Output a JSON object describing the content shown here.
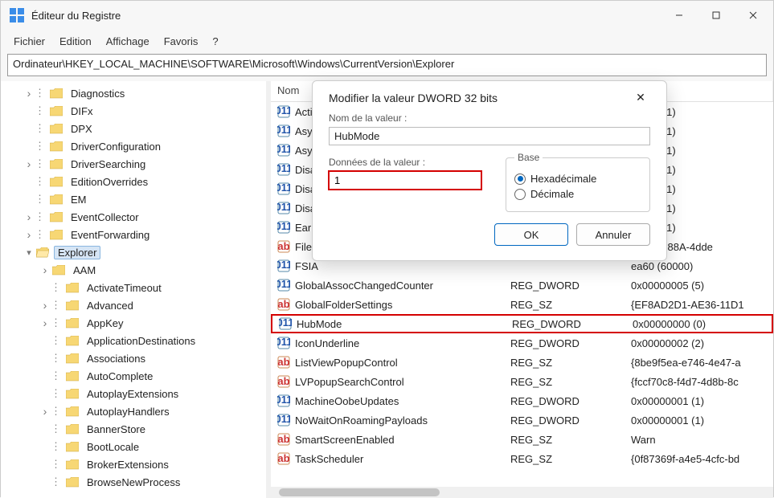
{
  "window": {
    "title": "Éditeur du Registre"
  },
  "menu": {
    "file": "Fichier",
    "edit": "Edition",
    "view": "Affichage",
    "fav": "Favoris",
    "help": "?"
  },
  "address": "Ordinateur\\HKEY_LOCAL_MACHINE\\SOFTWARE\\Microsoft\\Windows\\CurrentVersion\\Explorer",
  "tree": [
    {
      "depth": 1,
      "chev": "collapsed",
      "label": "Diagnostics",
      "dots": true
    },
    {
      "depth": 1,
      "chev": "none",
      "label": "DIFx",
      "dots": true
    },
    {
      "depth": 1,
      "chev": "none",
      "label": "DPX",
      "dots": true
    },
    {
      "depth": 1,
      "chev": "none",
      "label": "DriverConfiguration",
      "dots": true
    },
    {
      "depth": 1,
      "chev": "collapsed",
      "label": "DriverSearching",
      "dots": true
    },
    {
      "depth": 1,
      "chev": "none",
      "label": "EditionOverrides",
      "dots": true
    },
    {
      "depth": 1,
      "chev": "none",
      "label": "EM",
      "dots": true
    },
    {
      "depth": 1,
      "chev": "collapsed",
      "label": "EventCollector",
      "dots": true
    },
    {
      "depth": 1,
      "chev": "collapsed",
      "label": "EventForwarding",
      "dots": true
    },
    {
      "depth": 1,
      "chev": "expanded",
      "label": "Explorer",
      "dots": false,
      "selected": true,
      "open": true
    },
    {
      "depth": 2,
      "chev": "collapsed",
      "label": "AAM",
      "dots": false
    },
    {
      "depth": 2,
      "chev": "none",
      "label": "ActivateTimeout",
      "dots": true
    },
    {
      "depth": 2,
      "chev": "collapsed",
      "label": "Advanced",
      "dots": true
    },
    {
      "depth": 2,
      "chev": "collapsed",
      "label": "AppKey",
      "dots": true
    },
    {
      "depth": 2,
      "chev": "none",
      "label": "ApplicationDestinations",
      "dots": true
    },
    {
      "depth": 2,
      "chev": "none",
      "label": "Associations",
      "dots": true
    },
    {
      "depth": 2,
      "chev": "none",
      "label": "AutoComplete",
      "dots": true
    },
    {
      "depth": 2,
      "chev": "none",
      "label": "AutoplayExtensions",
      "dots": true
    },
    {
      "depth": 2,
      "chev": "collapsed",
      "label": "AutoplayHandlers",
      "dots": true
    },
    {
      "depth": 2,
      "chev": "none",
      "label": "BannerStore",
      "dots": true
    },
    {
      "depth": 2,
      "chev": "none",
      "label": "BootLocale",
      "dots": true
    },
    {
      "depth": 2,
      "chev": "none",
      "label": "BrokerExtensions",
      "dots": true
    },
    {
      "depth": 2,
      "chev": "none",
      "label": "BrowseNewProcess",
      "dots": true
    }
  ],
  "listHeader": {
    "name": "Nom",
    "type": "",
    "data": "es"
  },
  "rows": [
    {
      "icon": "bin",
      "name": "Activ",
      "type": "",
      "data": "00001 (1)"
    },
    {
      "icon": "bin",
      "name": "Asyn",
      "type": "",
      "data": "00001 (1)"
    },
    {
      "icon": "bin",
      "name": "Asyn",
      "type": "",
      "data": "00001 (1)"
    },
    {
      "icon": "bin",
      "name": "Disa",
      "type": "",
      "data": "00001 (1)"
    },
    {
      "icon": "bin",
      "name": "Disa",
      "type": "",
      "data": "00001 (1)"
    },
    {
      "icon": "bin",
      "name": "Disa",
      "type": "",
      "data": "00001 (1)"
    },
    {
      "icon": "bin",
      "name": "Early",
      "type": "",
      "data": "00001 (1)"
    },
    {
      "icon": "str",
      "name": "FileC",
      "type": "",
      "data": "5A9C-E88A-4dde"
    },
    {
      "icon": "bin",
      "name": "FSIA",
      "type": "",
      "data": "ea60 (60000)"
    },
    {
      "icon": "bin",
      "name": "GlobalAssocChangedCounter",
      "type": "REG_DWORD",
      "data": "0x00000005 (5)"
    },
    {
      "icon": "str",
      "name": "GlobalFolderSettings",
      "type": "REG_SZ",
      "data": "{EF8AD2D1-AE36-11D1"
    },
    {
      "icon": "bin",
      "name": "HubMode",
      "type": "REG_DWORD",
      "data": "0x00000000 (0)",
      "highlight": true
    },
    {
      "icon": "bin",
      "name": "IconUnderline",
      "type": "REG_DWORD",
      "data": "0x00000002 (2)"
    },
    {
      "icon": "str",
      "name": "ListViewPopupControl",
      "type": "REG_SZ",
      "data": "{8be9f5ea-e746-4e47-a"
    },
    {
      "icon": "str",
      "name": "LVPopupSearchControl",
      "type": "REG_SZ",
      "data": "{fccf70c8-f4d7-4d8b-8c"
    },
    {
      "icon": "bin",
      "name": "MachineOobeUpdates",
      "type": "REG_DWORD",
      "data": "0x00000001 (1)"
    },
    {
      "icon": "bin",
      "name": "NoWaitOnRoamingPayloads",
      "type": "REG_DWORD",
      "data": "0x00000001 (1)"
    },
    {
      "icon": "str",
      "name": "SmartScreenEnabled",
      "type": "REG_SZ",
      "data": "Warn"
    },
    {
      "icon": "str",
      "name": "TaskScheduler",
      "type": "REG_SZ",
      "data": "{0f87369f-a4e5-4cfc-bd"
    }
  ],
  "modal": {
    "title": "Modifier la valeur DWORD 32 bits",
    "nameLabel": "Nom de la valeur :",
    "nameValue": "HubMode",
    "dataLabel": "Données de la valeur :",
    "dataValue": "1",
    "baseLabel": "Base",
    "hex": "Hexadécimale",
    "dec": "Décimale",
    "ok": "OK",
    "cancel": "Annuler"
  }
}
